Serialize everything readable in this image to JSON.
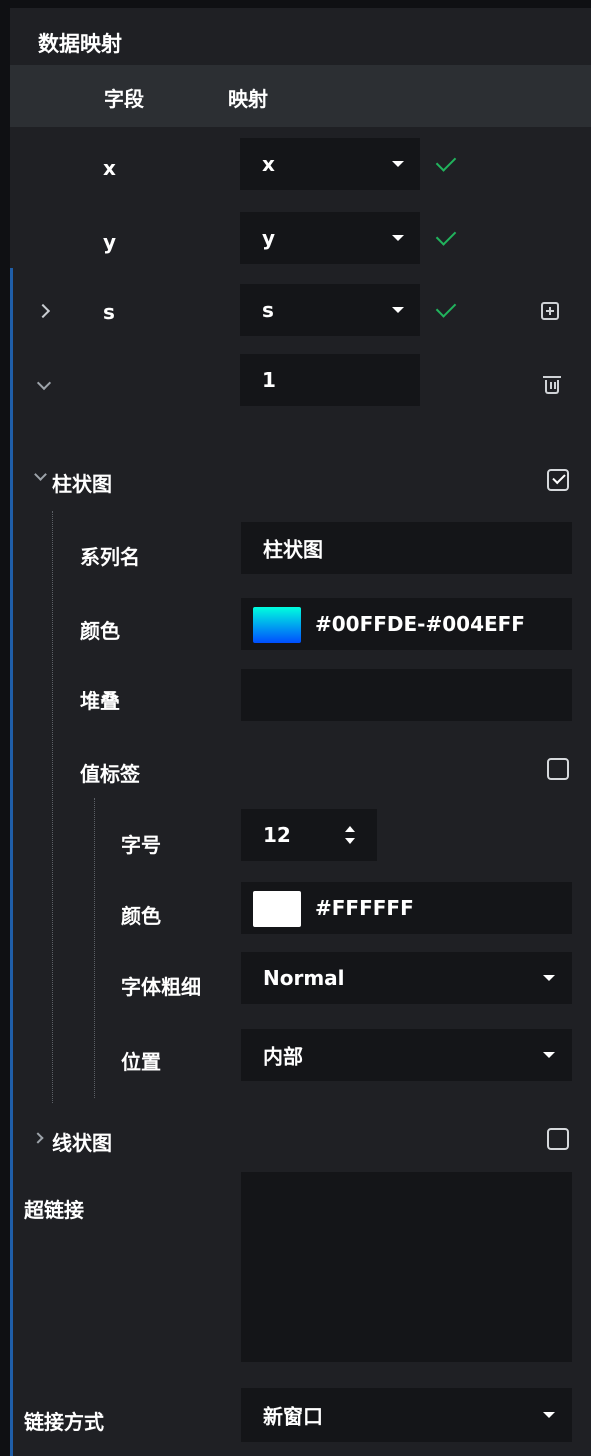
{
  "header": {
    "title": "数据映射"
  },
  "mapping": {
    "columns": {
      "field": "字段",
      "mapping": "映射"
    },
    "rows": [
      {
        "field": "x",
        "value": "x"
      },
      {
        "field": "y",
        "value": "y"
      },
      {
        "field": "s",
        "value": "s"
      }
    ],
    "extra_value": "1"
  },
  "bar": {
    "title": "柱状图",
    "enabled": true,
    "series_name_label": "系列名",
    "series_name_value": "柱状图",
    "color_label": "颜色",
    "color_value": "#00FFDE-#004EFF",
    "gradient_start": "#00FFDE",
    "gradient_end": "#004EFF",
    "stack_label": "堆叠",
    "stack_value": "",
    "value_label": {
      "title": "值标签",
      "enabled": false,
      "font_size_label": "字号",
      "font_size_value": "12",
      "color_label": "颜色",
      "color_value": "#FFFFFF",
      "weight_label": "字体粗细",
      "weight_value": "Normal",
      "position_label": "位置",
      "position_value": "内部"
    }
  },
  "line": {
    "title": "线状图",
    "enabled": false
  },
  "hyperlink": {
    "label": "超链接",
    "value": ""
  },
  "link_mode": {
    "label": "链接方式",
    "value": "新窗口"
  },
  "colors": {
    "accent": "#1f5ea8",
    "check": "#21b35d",
    "panel": "#1f2024",
    "input": "#141518"
  }
}
